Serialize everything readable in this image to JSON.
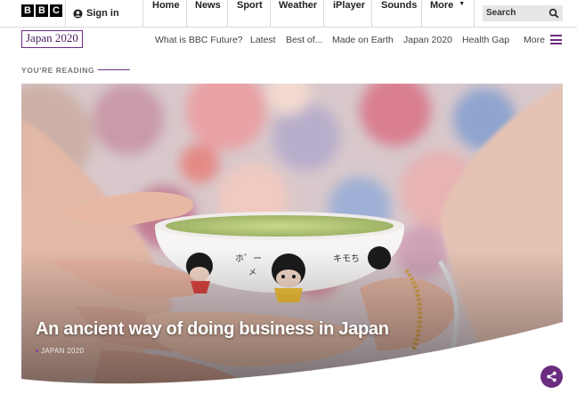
{
  "bbc_bar": {
    "logo_letters": [
      "B",
      "B",
      "C"
    ],
    "signin_label": "Sign in",
    "nav": [
      "Home",
      "News",
      "Sport",
      "Weather",
      "iPlayer",
      "Sounds",
      "More"
    ],
    "search_placeholder": "Search"
  },
  "future_nav": {
    "brand": "Japan 2020",
    "links": [
      "What is BBC Future?",
      "Latest",
      "Best of...",
      "Made on Earth",
      "Japan 2020",
      "Health Gap"
    ],
    "more_label": "More"
  },
  "reading": {
    "label": "YOU'RE READING"
  },
  "article": {
    "headline": "An ancient way of doing business in Japan",
    "tag": "JAPAN 2020"
  },
  "colors": {
    "accent": "#6b2c80"
  },
  "icons": [
    "user-icon",
    "search-icon",
    "menu-icon",
    "share-icon"
  ]
}
